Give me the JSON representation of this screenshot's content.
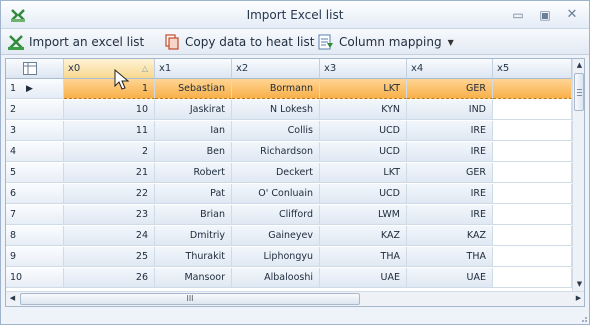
{
  "window": {
    "title": "Import Excel list",
    "minimize_glyph": "▭",
    "maximize_glyph": "▣",
    "close_glyph": "✕"
  },
  "toolbar": {
    "import_label": "Import an excel list",
    "copy_label": "Copy data to heat list",
    "mapping_label": "Column mapping",
    "mapping_caret": "▼"
  },
  "grid": {
    "columns": [
      "x0",
      "x1",
      "x2",
      "x3",
      "x4",
      "x5"
    ],
    "sort_glyph": "△",
    "selected_row": 1,
    "rows": [
      {
        "num": "1",
        "cells": [
          "1",
          "Sebastian",
          "Bormann",
          "LKT",
          "GER",
          ""
        ]
      },
      {
        "num": "2",
        "cells": [
          "10",
          "Jaskirat",
          "N Lokesh",
          "KYN",
          "IND",
          ""
        ]
      },
      {
        "num": "3",
        "cells": [
          "11",
          "Ian",
          "Collis",
          "UCD",
          "IRE",
          ""
        ]
      },
      {
        "num": "4",
        "cells": [
          "2",
          "Ben",
          "Richardson",
          "UCD",
          "IRE",
          ""
        ]
      },
      {
        "num": "5",
        "cells": [
          "21",
          "Robert",
          "Deckert",
          "LKT",
          "GER",
          ""
        ]
      },
      {
        "num": "6",
        "cells": [
          "22",
          "Pat",
          "O' Conluain",
          "UCD",
          "IRE",
          ""
        ]
      },
      {
        "num": "7",
        "cells": [
          "23",
          "Brian",
          "Clifford",
          "LWM",
          "IRE",
          ""
        ]
      },
      {
        "num": "8",
        "cells": [
          "24",
          "Dmitriy",
          "Gaineyev",
          "KAZ",
          "KAZ",
          ""
        ]
      },
      {
        "num": "9",
        "cells": [
          "25",
          "Thurakit",
          "Liphongyu",
          "THA",
          "THA",
          ""
        ]
      },
      {
        "num": "10",
        "cells": [
          "26",
          "Mansoor",
          "Albalooshi",
          "UAE",
          "UAE",
          ""
        ]
      }
    ],
    "hscroll_label": "III"
  },
  "colors": {
    "selection": "#f8b049",
    "header": "#dde6f1",
    "accent_green": "#2e8b3a"
  },
  "icons": [
    "excel-app-icon",
    "excel-import-icon",
    "copy-icon",
    "column-mapping-icon",
    "row-pointer-icon",
    "grid-corner-icon",
    "mouse-cursor-icon"
  ]
}
